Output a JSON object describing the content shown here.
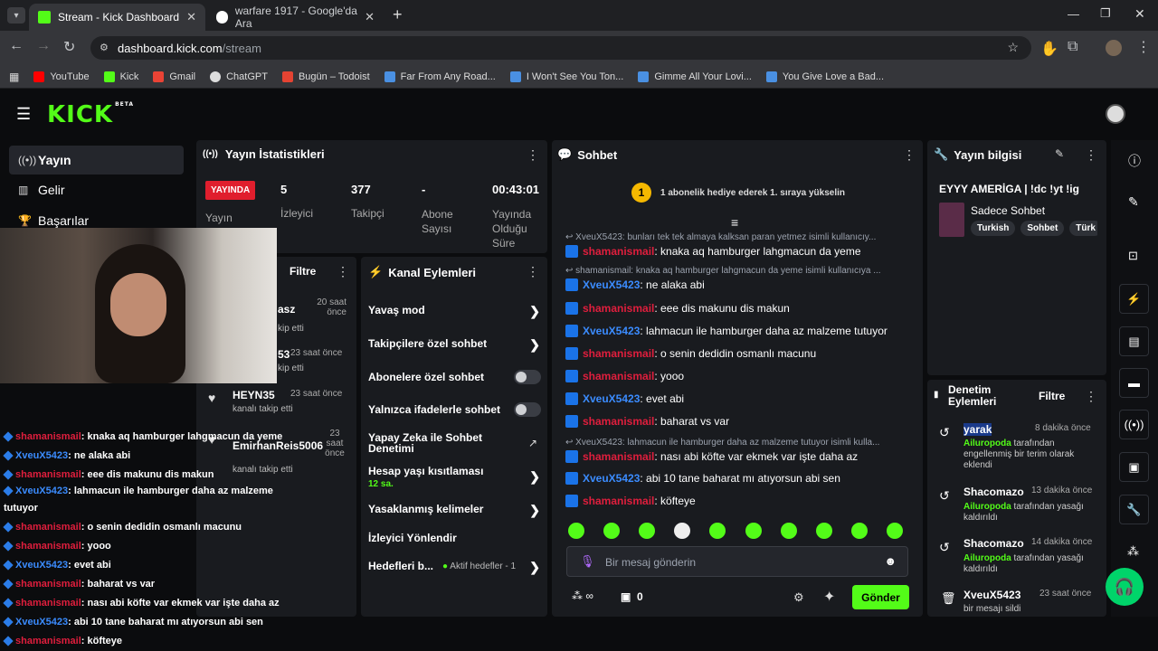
{
  "browser": {
    "tabs": [
      {
        "label": "Stream - Kick Dashboard",
        "active": true
      },
      {
        "label": "warfare 1917 - Google'da Ara",
        "active": false
      }
    ],
    "url_host": "dashboard.kick.com",
    "url_path": "/stream",
    "bookmarks": [
      "YouTube",
      "Kick",
      "Gmail",
      "ChatGPT",
      "Bugün – Todoist",
      "Far From Any Road...",
      "I Won't See You Ton...",
      "Gimme All Your Lovi...",
      "You Give Love a Bad..."
    ]
  },
  "kick": {
    "logo": "KICK",
    "logo_badge": "BETA",
    "brand_color": "#53fc18",
    "sidebar": [
      {
        "label": "Yayın",
        "icon": "broadcast-icon"
      },
      {
        "label": "Gelir",
        "icon": "chart-icon"
      },
      {
        "label": "Başarılar",
        "icon": "trophy-icon"
      }
    ],
    "stats": {
      "title": "Yayın İstatistikleri",
      "live_badge": "YAYINDA",
      "status_label": "Yayın",
      "viewers_value": "5",
      "viewers_label": "İzleyici",
      "followers_value": "377",
      "followers_label": "Takipçi",
      "subs_value": "-",
      "subs_label": "Abone Sayısı",
      "uptime_value": "00:43:01",
      "uptime_label": "Yayında Olduğu Süre"
    },
    "activity": {
      "filter": "Filtre",
      "items": [
        {
          "name": "asz",
          "time": "20 saat önce",
          "desc": "kip etti"
        },
        {
          "name": "53",
          "time": "23 saat önce",
          "desc": "kip etti"
        },
        {
          "name": "HEYN35",
          "time": "23 saat önce",
          "desc": "kanalı takip etti"
        },
        {
          "name": "EmirhanReis5006",
          "time": "23 saat önce",
          "desc": "kanalı takip etti"
        }
      ]
    },
    "channel_actions": {
      "title": "Kanal Eylemleri",
      "items": [
        {
          "label": "Yavaş mod"
        },
        {
          "label": "Takipçilere özel sohbet"
        },
        {
          "label": "Abonelere özel sohbet"
        },
        {
          "label": "Yalnızca ifadelerle sohbet"
        },
        {
          "label": "Yapay Zeka ile Sohbet Denetimi"
        },
        {
          "label": "Hesap yaşı kısıtlaması",
          "sub": "12 sa."
        },
        {
          "label": "Yasaklanmış kelimeler"
        },
        {
          "label": "İzleyici Yönlendir"
        },
        {
          "label": "Hedefleri b...",
          "sub": "Aktif hedefler - 1"
        }
      ]
    },
    "chat": {
      "title": "Sohbet",
      "gift_rank": "1",
      "gift_text": "1 abonelik hediye ederek 1. sıraya yükselin",
      "replies": [
        "XveuX5423: bunları tek tek almaya kalksan paran yetmez isimli kullanıcıy...",
        "shamanismail: knaka aq hamburger lahgmacun da yeme isimli kullanıcıya ...",
        "XveuX5423: lahmacun ile hamburger daha az malzeme tutuyor isimli kulla..."
      ],
      "messages": [
        {
          "user": "shamanismail",
          "text": ": knaka aq hamburger lahgmacun da yeme"
        },
        {
          "user": "XveuX5423",
          "text": ": ne alaka abi"
        },
        {
          "user": "shamanismail",
          "text": ": eee dis makunu dis makun"
        },
        {
          "user": "XveuX5423",
          "text": ": lahmacun ile hamburger daha az malzeme tutuyor"
        },
        {
          "user": "shamanismail",
          "text": ": o senin dedidin osmanlı macunu"
        },
        {
          "user": "shamanismail",
          "text": ": yooo"
        },
        {
          "user": "XveuX5423",
          "text": ": evet abi"
        },
        {
          "user": "shamanismail",
          "text": ": baharat vs var"
        },
        {
          "user": "shamanismail",
          "text": ": nası abi köfte var ekmek var işte daha az"
        },
        {
          "user": "XveuX5423",
          "text": ": abi 10 tane baharat mı atıyorsun abi sen"
        },
        {
          "user": "shamanismail",
          "text": ": köfteye"
        }
      ],
      "input_placeholder": "Bir mesaj gönderin",
      "points": "∞",
      "store_count": "0",
      "send": "Gönder"
    },
    "stream_info": {
      "title": "Yayın bilgisi",
      "stream_title": "EYYY AMERİGA | !dc !yt !ig",
      "category": "Sadece Sohbet",
      "tags": [
        "Turkish",
        "Sohbet",
        "Türk"
      ]
    },
    "moderation": {
      "title": "Denetim Eylemleri",
      "filter": "Filtre",
      "items": [
        {
          "user": "yarak",
          "time": "8 dakika önce",
          "by": "Ailuropoda",
          "text": " tarafından engellenmiş bir terim olarak eklendi"
        },
        {
          "user": "Shacomazo",
          "time": "13 dakika önce",
          "by": "Ailuropoda",
          "text": " tarafından yasağı kaldırıldı"
        },
        {
          "user": "Shacomazo",
          "time": "14 dakika önce",
          "by": "Ailuropoda",
          "text": " tarafından yasağı kaldırıldı"
        },
        {
          "user": "XveuX5423",
          "time": "23 saat önce",
          "by": "",
          "text": "bir mesajı sildi"
        }
      ]
    },
    "overlay": [
      {
        "user": "shamanismail",
        "text": ": knaka aq hamburger lahgmacun da yeme"
      },
      {
        "user": "XveuX5423",
        "text": ": ne alaka abi"
      },
      {
        "user": "shamanismail",
        "text": ": eee dis makunu dis makun"
      },
      {
        "user": "XveuX5423",
        "text": ": lahmacun ile hamburger daha az malzeme"
      },
      {
        "user": "",
        "text": "tutuyor"
      },
      {
        "user": "shamanismail",
        "text": ": o senin dedidin osmanlı macunu"
      },
      {
        "user": "shamanismail",
        "text": ": yooo"
      },
      {
        "user": "XveuX5423",
        "text": ": evet abi"
      },
      {
        "user": "shamanismail",
        "text": ": baharat vs var"
      },
      {
        "user": "shamanismail",
        "text": ": nası abi köfte var ekmek var işte daha az"
      },
      {
        "user": "XveuX5423",
        "text": ": abi 10 tane baharat mı atıyorsun abi sen"
      },
      {
        "user": "shamanismail",
        "text": ": köfteye"
      }
    ]
  }
}
